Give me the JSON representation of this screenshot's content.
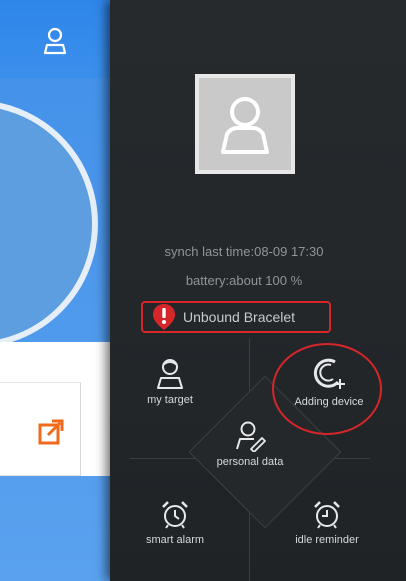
{
  "menu": {
    "sync_text": "synch last time:08-09 17:30",
    "battery_text": "battery:about 100 %",
    "unbound_label": "Unbound Bracelet",
    "items": [
      {
        "label": "my target",
        "icon": "target-person-icon"
      },
      {
        "label": "Adding device",
        "icon": "add-device-icon"
      },
      {
        "label": "personal data",
        "icon": "personal-data-icon"
      },
      {
        "label": "smart alarm",
        "icon": "alarm-clock-icon"
      },
      {
        "label": "idle reminder",
        "icon": "idle-clock-icon"
      }
    ]
  },
  "colors": {
    "menu_bg": "#23272a",
    "highlight_red": "#d7262a",
    "app_blue": "#3f8fe8",
    "share_orange": "#f06a1c"
  }
}
